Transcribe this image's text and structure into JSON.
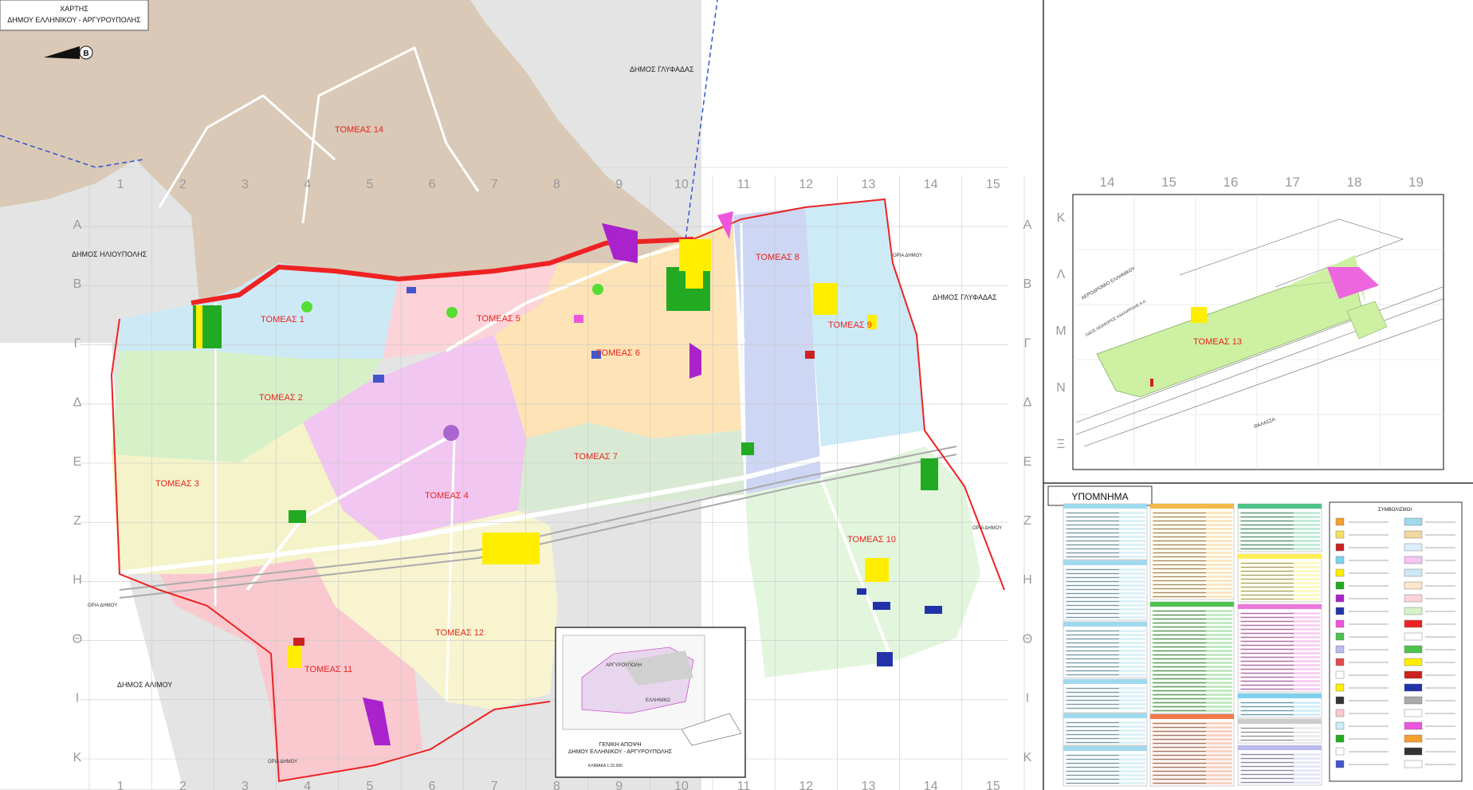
{
  "title": {
    "line1": "ΧΑΡΤΗΣ",
    "line2": "ΔΗΜΟΥ ΕΛΛΗΝΙΚΟΥ - ΑΡΓΥΡΟΥΠΟΛΗΣ"
  },
  "north_arrow_label": "B",
  "municipalities": {
    "glyfada_top": "ΔΗΜΟΣ ΓΛΥΦΑΔΑΣ",
    "glyfada_right": "ΔΗΜΟΣ ΓΛΥΦΑΔΑΣ",
    "ilioupoli": "ΔΗΜΟΣ ΗΛΙΟΥΠΟΛΗΣ",
    "alimos": "ΔΗΜΟΣ ΑΛΙΜΟΥ"
  },
  "boundary_labels": {
    "b1": "ΟΡΙΑ ΔΗΜΟΥ",
    "b2": "ΟΡΙΑ ΔΗΜΟΥ",
    "b3": "ΟΡΙΑ ΔΗΜΟΥ",
    "b4": "ΟΡΙΑ ΔΗΜΟΥ"
  },
  "sectors": {
    "s1": "ΤΟΜΕΑΣ 1",
    "s2": "ΤΟΜΕΑΣ 2",
    "s3": "ΤΟΜΕΑΣ 3",
    "s4": "ΤΟΜΕΑΣ 4",
    "s5": "ΤΟΜΕΑΣ 5",
    "s6": "ΤΟΜΕΑΣ 6",
    "s7": "ΤΟΜΕΑΣ 7",
    "s8": "ΤΟΜΕΑΣ 8",
    "s9": "ΤΟΜΕΑΣ 9",
    "s10": "ΤΟΜΕΑΣ 10",
    "s11": "ΤΟΜΕΑΣ 11",
    "s12": "ΤΟΜΕΑΣ 12",
    "s13": "ΤΟΜΕΑΣ 13",
    "s14": "ΤΟΜΕΑΣ 14"
  },
  "grid_columns": [
    "1",
    "2",
    "3",
    "4",
    "5",
    "6",
    "7",
    "8",
    "9",
    "10",
    "11",
    "12",
    "13",
    "14",
    "15"
  ],
  "grid_rows": [
    "Α",
    "Β",
    "Γ",
    "Δ",
    "Ε",
    "Ζ",
    "Η",
    "Θ",
    "Ι",
    "Κ"
  ],
  "inset13": {
    "columns": [
      "14",
      "15",
      "16",
      "17",
      "18",
      "19"
    ],
    "rows": [
      "Κ",
      "Λ",
      "Μ",
      "Ν",
      "Ξ"
    ],
    "airport_label": "ΑΕΡΟΔΡΟΜΙΟ ΕΛΛΗΝΙΚΟΥ",
    "road_label": "ΟΔΟΣ ΛΕΩΦΟΡΟΣ ΚΑΛΛΙΡΡΟΗΣ Α.Κ.",
    "sea_label": "ΘΑΛΑΣΣΑ"
  },
  "overview": {
    "line1": "ΓΕΝΙΚΗ ΑΠΟΨΗ",
    "line2": "ΔΗΜΟΥ ΕΛΛΗΝΙΚΟΥ - ΑΡΓΥΡΟΥΠΟΛΗΣ",
    "scale": "ΚΛΙΜΑΚΑ 1:15.000",
    "argyroupoli": "ΑΡΓΥΡΟΥΠΟΛΗ",
    "elliniko": "ΕΛΛΗΝΙΚΟ"
  },
  "legend": {
    "title": "ΥΠΟΜΝΗΜΑ",
    "symbols_title": "ΣΥΜΒΟΛΙΣΜΟΙ"
  },
  "colors": {
    "s1": "#cde9f6",
    "s2": "#d6f0c8",
    "s3": "#f4f3c9",
    "s4": "#f1c6f0",
    "s5": "#fbd3d8",
    "s6": "#fde3b6",
    "s7": "#d9ead4",
    "s8": "#cdd6f2",
    "s9": "#cdeaf7",
    "s10": "#e2f5dd",
    "s11": "#f9c9cf",
    "s12": "#f7f4cf",
    "s13": "#cdf0a3",
    "s14": "#d9c9b6",
    "boundary": "#ee2222",
    "grid": "#c9c9c9"
  }
}
